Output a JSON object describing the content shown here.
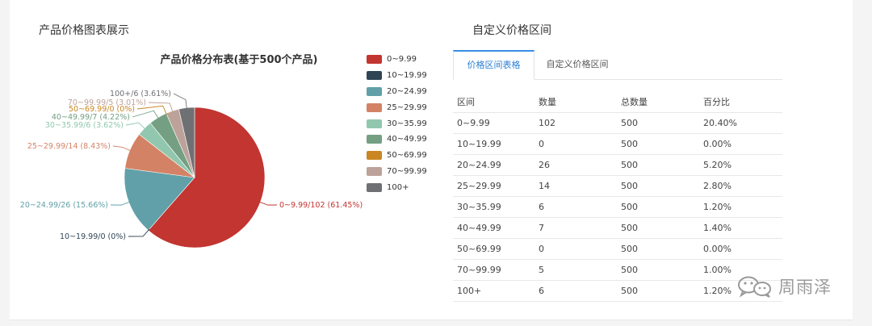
{
  "left_section": {
    "title": "产品价格图表展示"
  },
  "right_section": {
    "title": "自定义价格区间"
  },
  "chart_data": {
    "type": "pie",
    "title": "产品价格分布表(基于500个产品)",
    "categories": [
      "0~9.99",
      "10~19.99",
      "20~24.99",
      "25~29.99",
      "30~35.99",
      "40~49.99",
      "50~69.99",
      "70~99.99",
      "100+"
    ],
    "values": [
      102,
      0,
      26,
      14,
      6,
      7,
      0,
      5,
      6
    ],
    "percents": [
      61.45,
      0,
      15.66,
      8.43,
      3.62,
      4.22,
      0,
      3.01,
      3.61
    ],
    "colors": [
      "#c23531",
      "#2f4554",
      "#61a0a8",
      "#d48265",
      "#91c7ae",
      "#749f83",
      "#ca8622",
      "#bda29a",
      "#6e7074"
    ],
    "labels": [
      "0~9.99/102 (61.45%)",
      "10~19.99/0 (0%)",
      "20~24.99/26 (15.66%)",
      "25~29.99/14 (8.43%)",
      "30~35.99/6 (3.62%)",
      "40~49.99/7 (4.22%)",
      "50~69.99/0 (0%)",
      "70~99.99/5 (3.01%)",
      "100+/6 (3.61%)"
    ],
    "legend_position": "right"
  },
  "tabs": [
    {
      "label": "价格区间表格",
      "active": true
    },
    {
      "label": "自定义价格区间",
      "active": false
    }
  ],
  "table": {
    "headers": [
      "区间",
      "数量",
      "总数量",
      "百分比"
    ],
    "rows": [
      [
        "0~9.99",
        "102",
        "500",
        "20.40%"
      ],
      [
        "10~19.99",
        "0",
        "500",
        "0.00%"
      ],
      [
        "20~24.99",
        "26",
        "500",
        "5.20%"
      ],
      [
        "25~29.99",
        "14",
        "500",
        "2.80%"
      ],
      [
        "30~35.99",
        "6",
        "500",
        "1.20%"
      ],
      [
        "40~49.99",
        "7",
        "500",
        "1.40%"
      ],
      [
        "50~69.99",
        "0",
        "500",
        "0.00%"
      ],
      [
        "70~99.99",
        "5",
        "500",
        "1.00%"
      ],
      [
        "100+",
        "6",
        "500",
        "1.20%"
      ]
    ]
  },
  "watermark": {
    "text": "周雨泽",
    "icon": "wechat-icon"
  }
}
